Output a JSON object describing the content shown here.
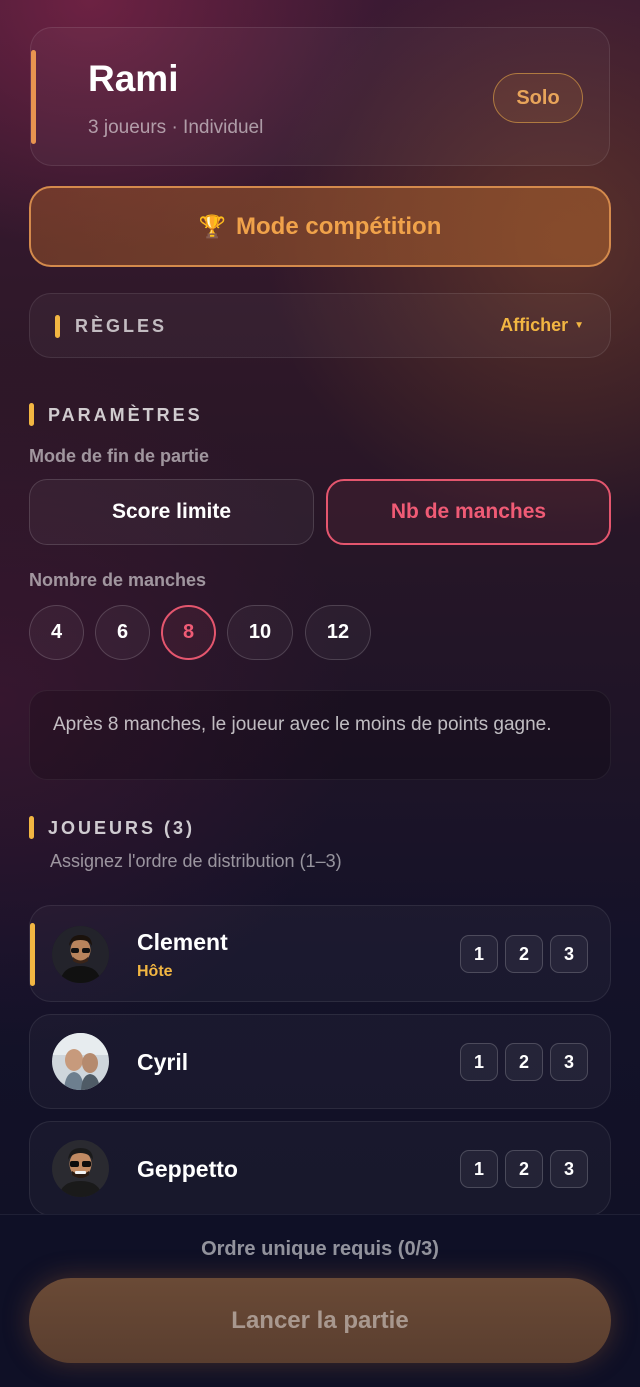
{
  "header": {
    "title": "Rami",
    "subtitle": "3 joueurs · Individuel",
    "badge": "Solo"
  },
  "competition": {
    "icon": "trophy-icon",
    "label": "Mode compétition"
  },
  "rules": {
    "label": "RÈGLES",
    "toggle": "Afficher"
  },
  "params": {
    "title": "PARAMÈTRES",
    "end_mode_label": "Mode de fin de partie",
    "end_modes": [
      "Score limite",
      "Nb de manches"
    ],
    "end_mode_selected": "Nb de manches",
    "rounds_label": "Nombre de manches",
    "rounds": [
      "4",
      "6",
      "8",
      "10",
      "12"
    ],
    "rounds_selected": "8",
    "info": "Après 8 manches, le joueur avec le moins de points gagne."
  },
  "players_section": {
    "title": "JOUEURS (3)",
    "subtitle": "Assignez l'ordre de distribution (1–3)",
    "order_options": [
      "1",
      "2",
      "3"
    ],
    "players": [
      {
        "name": "Clement",
        "role": "Hôte"
      },
      {
        "name": "Cyril"
      },
      {
        "name": "Geppetto"
      }
    ]
  },
  "footer": {
    "status": "Ordre unique requis (0/3)",
    "launch": "Lancer la partie"
  },
  "colors": {
    "accent_gold": "#f2b642",
    "accent_pink": "#e4566e",
    "accent_orange": "#d48a4c"
  }
}
